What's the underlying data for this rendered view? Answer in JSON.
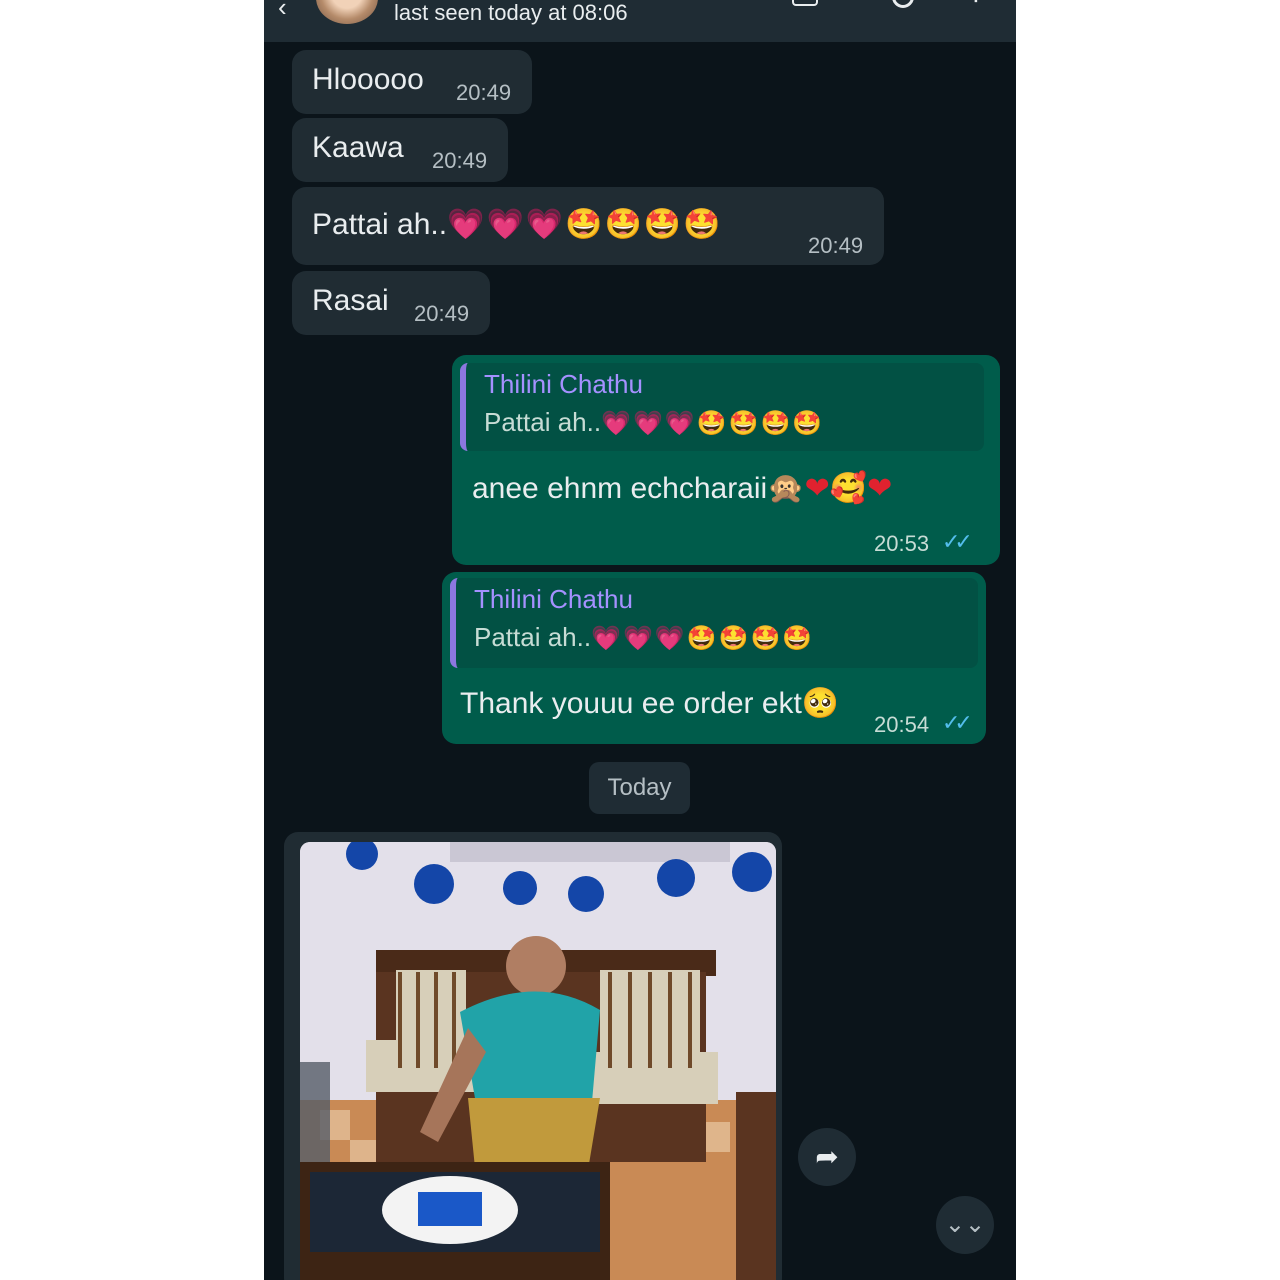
{
  "header": {
    "back_icon": "back-arrow-icon",
    "status": "last seen today at 08:06"
  },
  "messages": [
    {
      "direction": "in",
      "text": "Hlooooo",
      "time": "20:49"
    },
    {
      "direction": "in",
      "text": "Kaawa",
      "time": "20:49"
    },
    {
      "direction": "in",
      "text": "Pattai ah..",
      "emoji_hearts": "💗💗💗",
      "emoji_stars": "🤩🤩🤩🤩",
      "time": "20:49"
    },
    {
      "direction": "in",
      "text": "Rasai",
      "time": "20:49"
    },
    {
      "direction": "out",
      "quote": {
        "name": "Thilini Chathu",
        "text": "Pattai ah..",
        "emoji_hearts": "💗💗💗",
        "emoji_stars": "🤩🤩🤩🤩"
      },
      "text": "anee ehnm echcharaii",
      "emoji_a": "🙊",
      "emoji_b": "❤",
      "emoji_c": "🥰",
      "emoji_d": "❤",
      "time": "20:53",
      "ticks": "✓✓"
    },
    {
      "direction": "out",
      "quote": {
        "name": "Thilini Chathu",
        "text": "Pattai ah..",
        "emoji_hearts": "💗💗💗",
        "emoji_stars": "🤩🤩🤩🤩"
      },
      "text": "Thank youuu ee order ekt",
      "emoji_a": "🥺",
      "time": "20:54",
      "ticks": "✓✓"
    }
  ],
  "date_divider": "Today",
  "photo_message": {
    "description_icon": "image-icon"
  },
  "buttons": {
    "share_icon": "➦",
    "scroll_down_icon": "⌄⌄"
  },
  "colors": {
    "background": "#0b141a",
    "incoming_bubble": "#202c33",
    "outgoing_bubble": "#005c4b",
    "quote_name": "#a591ff",
    "read_ticks": "#53bdeb"
  }
}
